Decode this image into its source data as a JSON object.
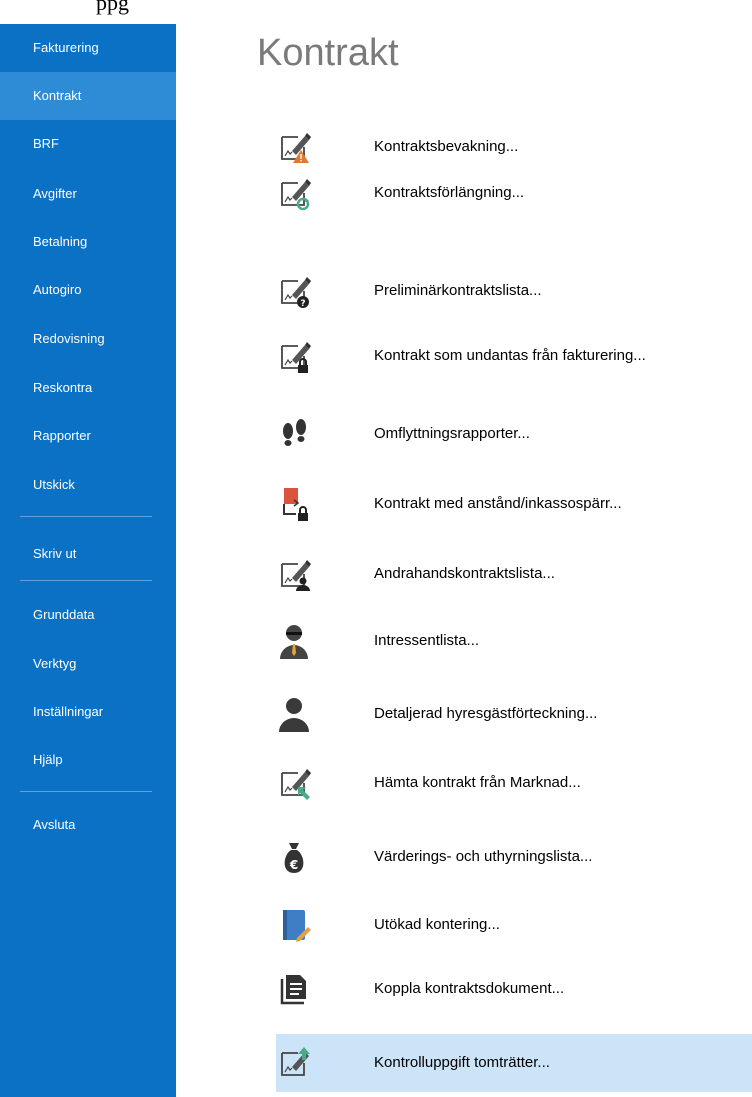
{
  "sidebar": {
    "items": [
      {
        "label": "Fakturering"
      },
      {
        "label": "Kontrakt"
      },
      {
        "label": "BRF"
      },
      {
        "label": "Avgifter"
      },
      {
        "label": "Betalning"
      },
      {
        "label": "Autogiro"
      },
      {
        "label": "Redovisning"
      },
      {
        "label": "Reskontra"
      },
      {
        "label": "Rapporter"
      },
      {
        "label": "Utskick"
      },
      {
        "label": "Skriv ut"
      },
      {
        "label": "Grunddata"
      },
      {
        "label": "Verktyg"
      },
      {
        "label": "Inställningar"
      },
      {
        "label": "Hjälp"
      },
      {
        "label": "Avsluta"
      }
    ],
    "active": "Kontrakt"
  },
  "main": {
    "title": "Kontrakt",
    "items": [
      {
        "label": "Kontraktsbevakning...",
        "icon": "contract-warning-icon"
      },
      {
        "label": "Kontraktsförlängning...",
        "icon": "contract-renew-icon"
      },
      {
        "label": "Preliminärkontraktslista...",
        "icon": "contract-question-icon"
      },
      {
        "label": "Kontrakt som undantas från fakturering...",
        "icon": "contract-lock-icon"
      },
      {
        "label": "Omflyttningsrapporter...",
        "icon": "footprints-icon"
      },
      {
        "label": "Kontrakt med anstånd/inkassospärr...",
        "icon": "card-lock-icon"
      },
      {
        "label": "Andrahandskontraktslista...",
        "icon": "contract-person-icon"
      },
      {
        "label": "Intressentlista...",
        "icon": "interested-person-icon"
      },
      {
        "label": "Detaljerad hyresgästförteckning...",
        "icon": "person-icon"
      },
      {
        "label": "Hämta kontrakt från Marknad...",
        "icon": "contract-fetch-icon"
      },
      {
        "label": "Värderings- och uthyrningslista...",
        "icon": "money-bag-euro-icon"
      },
      {
        "label": "Utökad kontering...",
        "icon": "book-edit-icon"
      },
      {
        "label": "Koppla kontraktsdokument...",
        "icon": "documents-icon"
      },
      {
        "label": "Kontrolluppgift tomträtter...",
        "icon": "contract-upload-icon"
      }
    ],
    "selected": "Kontrolluppgift tomträtter..."
  },
  "colors": {
    "sidebar": "#0a71c5",
    "sidebar_active": "#2e8bd6",
    "selected_row": "#cce4f7",
    "title": "#7a7a7a"
  },
  "top_fragment": "ppg"
}
